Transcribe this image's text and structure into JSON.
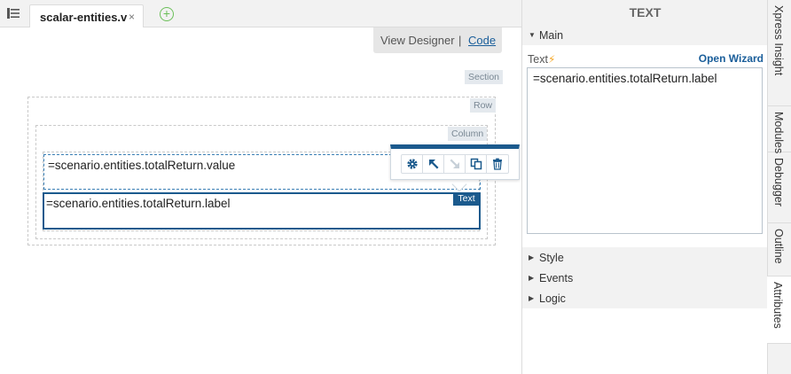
{
  "editor": {
    "menu_icon": "list-menu-icon",
    "tab_title": "scalar-entities.v",
    "tab_close": "×",
    "add_tab": "+"
  },
  "canvas": {
    "view_designer": "View Designer",
    "separator": "|",
    "code": "Code",
    "section_tag": "Section",
    "row_tag": "Row",
    "column_tag": "Column",
    "value_component_text": "=scenario.entities.totalReturn.value",
    "label_component_text": "=scenario.entities.totalReturn.label",
    "selected_badge": "Text",
    "toolbar": {
      "icons": [
        "gear-icon",
        "move-up-icon",
        "move-down-icon",
        "copy-icon",
        "trash-icon"
      ]
    }
  },
  "panel": {
    "title": "TEXT",
    "main": {
      "header": "Main",
      "field_label": "Text",
      "open_wizard": "Open Wizard",
      "value": "=scenario.entities.totalReturn.label"
    },
    "sections": [
      "Style",
      "Events",
      "Logic"
    ]
  },
  "side_tabs": [
    "Xpress Insight",
    "Modules",
    "Debugger",
    "Outline",
    "Attributes"
  ],
  "colors": {
    "accent": "#1b5a8d",
    "link": "#1a5e9a",
    "add_green": "#6bbf59",
    "bolt": "#f5a623"
  }
}
